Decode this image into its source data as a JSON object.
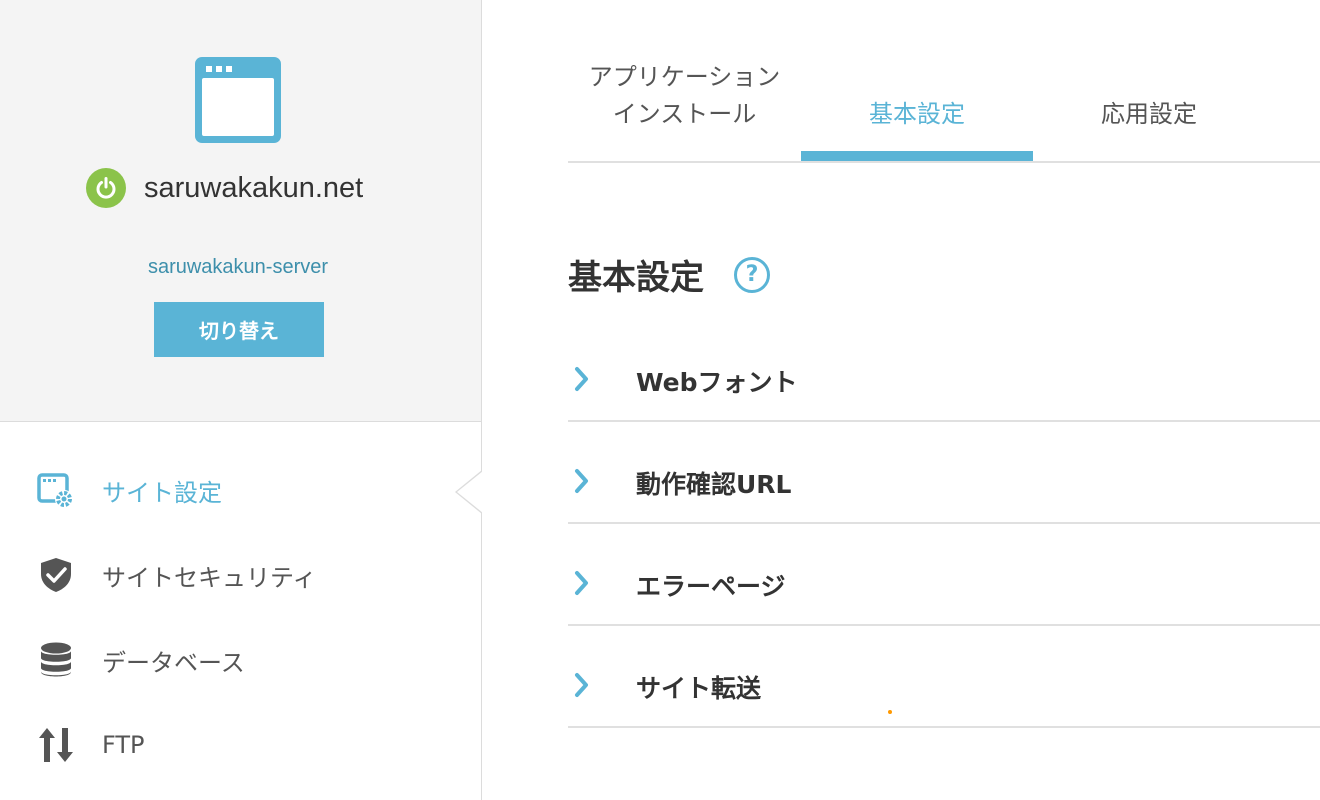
{
  "site_panel": {
    "site_icon": "browser-window-icon",
    "status_icon": "power-icon",
    "status_color": "#8bc34a",
    "domain": "saruwakakun.net",
    "server_name": "saruwakakun-server",
    "switch_label": "切り替え"
  },
  "nav": {
    "items": [
      {
        "label": "サイト設定",
        "icon": "browser-gear-icon",
        "active": true
      },
      {
        "label": "サイトセキュリティ",
        "icon": "shield-check-icon",
        "active": false
      },
      {
        "label": "データベース",
        "icon": "database-icon",
        "active": false
      },
      {
        "label": "FTP",
        "icon": "up-down-arrows-icon",
        "active": false
      }
    ]
  },
  "tabs": [
    {
      "line1": "アプリケーション",
      "line2": "インストール",
      "active": false
    },
    {
      "label": "基本設定",
      "active": true
    },
    {
      "label": "応用設定",
      "active": false
    }
  ],
  "main": {
    "title": "基本設定",
    "help_icon": "question-circle-icon",
    "sections": [
      {
        "label": "Webフォント"
      },
      {
        "label": "動作確認URL"
      },
      {
        "label": "エラーページ"
      },
      {
        "label": "サイト転送"
      }
    ]
  },
  "colors": {
    "accent": "#5ab4d6",
    "server_link": "#3d8fab",
    "status_on": "#8bc34a"
  }
}
